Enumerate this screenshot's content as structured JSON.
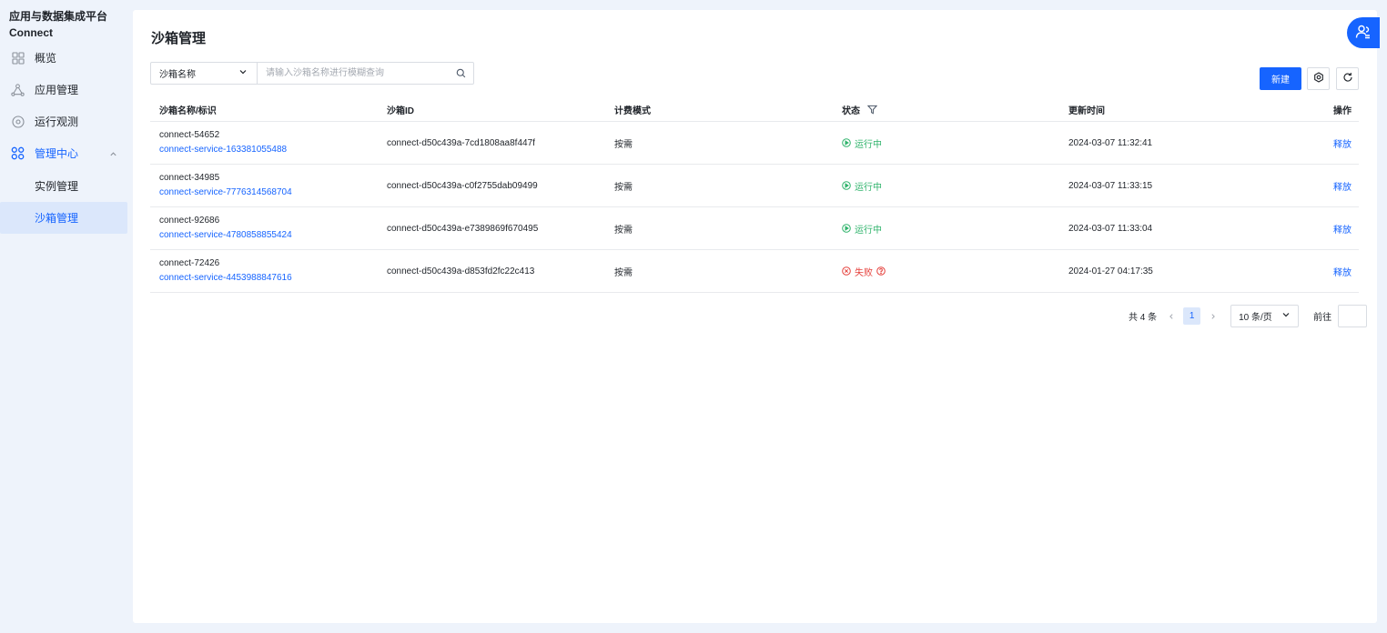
{
  "brand": {
    "line1": "应用与数据集成平台",
    "line2": "Connect"
  },
  "nav": {
    "overview": "概览",
    "app_mgmt": "应用管理",
    "observe": "运行观测",
    "mgmt_center": "管理中心",
    "instance_mgmt": "实例管理",
    "sandbox_mgmt": "沙箱管理"
  },
  "page": {
    "title": "沙箱管理"
  },
  "search": {
    "field_select": "沙箱名称",
    "placeholder": "请输入沙箱名称进行模糊查询"
  },
  "toolbar": {
    "new_label": "新建"
  },
  "table": {
    "headers": {
      "name": "沙箱名称/标识",
      "id": "沙箱ID",
      "billing": "计费模式",
      "status": "状态",
      "updated": "更新时间",
      "action": "操作"
    },
    "rows": [
      {
        "name": "connect-54652",
        "tag": "connect-service-163381055488",
        "id": "connect-d50c439a-7cd1808aa8f447f",
        "billing": "按需",
        "status": "运行中",
        "updated": "2024-03-07 11:32:41",
        "action": "释放"
      },
      {
        "name": "connect-34985",
        "tag": "connect-service-7776314568704",
        "id": "connect-d50c439a-c0f2755dab09499",
        "billing": "按需",
        "status": "运行中",
        "updated": "2024-03-07 11:33:15",
        "action": "释放"
      },
      {
        "name": "connect-92686",
        "tag": "connect-service-4780858855424",
        "id": "connect-d50c439a-e7389869f670495",
        "billing": "按需",
        "status": "运行中",
        "updated": "2024-03-07 11:33:04",
        "action": "释放"
      },
      {
        "name": "connect-72426",
        "tag": "connect-service-4453988847616",
        "id": "connect-d50c439a-d853fd2fc22c413",
        "billing": "按需",
        "status": "失败",
        "updated": "2024-01-27 04:17:35",
        "action": "释放"
      }
    ]
  },
  "pagination": {
    "total": "共 4 条",
    "current_page": "1",
    "page_size": "10 条/页",
    "goto_label": "前往"
  },
  "colors": {
    "accent": "#1664ff",
    "success": "#2fb36b",
    "error": "#e5413c"
  }
}
